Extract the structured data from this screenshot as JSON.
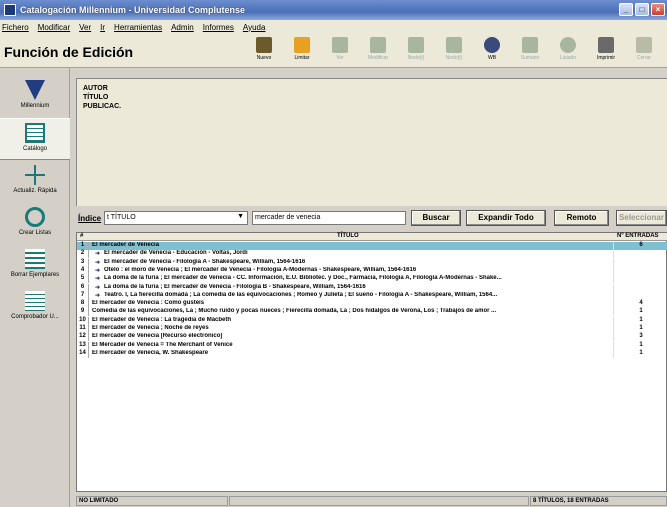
{
  "window": {
    "title": "Catalogación Millennium - Universidad Complutense"
  },
  "menu": [
    "Fichero",
    "Modificar",
    "Ver",
    "Ir",
    "Herramientas",
    "Admin",
    "Informes",
    "Ayuda"
  ],
  "mode_title": "Función de Edición",
  "toolbar": [
    {
      "label": "Nuevo",
      "icon": "new-record-icon",
      "enabled": true
    },
    {
      "label": "Limitar",
      "icon": "limit-icon",
      "enabled": true
    },
    {
      "label": "Ver",
      "icon": "view-icon",
      "enabled": false
    },
    {
      "label": "Modificar",
      "icon": "edit-icon",
      "enabled": false
    },
    {
      "label": "Nodo(t)",
      "icon": "nodes-icon",
      "enabled": false
    },
    {
      "label": "Nodo(t)",
      "icon": "unlink-icon",
      "enabled": false
    },
    {
      "label": "WB",
      "icon": "web-icon",
      "enabled": true
    },
    {
      "label": "Sumario",
      "icon": "summary-icon",
      "enabled": false
    },
    {
      "label": "Listado",
      "icon": "search-icon",
      "enabled": false
    },
    {
      "label": "Imprimir",
      "icon": "printer-icon",
      "enabled": true
    },
    {
      "label": "Cerrar",
      "icon": "close-icon",
      "enabled": false
    }
  ],
  "sidebar": [
    {
      "label": "Millennium",
      "icon": "millennium-icon"
    },
    {
      "label": "Catálogo",
      "icon": "catalog-icon"
    },
    {
      "label": "Actualiz. Rápida",
      "icon": "quick-update-icon"
    },
    {
      "label": "Crear Listas",
      "icon": "create-lists-icon"
    },
    {
      "label": "Borrar Ejemplares",
      "icon": "delete-items-icon"
    },
    {
      "label": "Comprobador U...",
      "icon": "checker-icon"
    }
  ],
  "record_fields": [
    "AUTOR",
    "TÍTULO",
    "PUBLICAC."
  ],
  "search": {
    "index_label": "Índice",
    "index_value": "t TÍTULO",
    "query": "mercader de venecia",
    "buttons": [
      "Buscar",
      "Expandir Todo",
      "Remoto",
      "Seleccionar"
    ]
  },
  "table": {
    "headers": [
      "#",
      "TÍTULO",
      "Nº ENTRADAS"
    ],
    "rows": [
      {
        "n": "1",
        "title": "El mercader de Venecia",
        "count": "6",
        "indent": false,
        "selected": true
      },
      {
        "n": "2",
        "title": "El mercader de Venecia - Educación - Voltas, Jordi",
        "count": "",
        "indent": true,
        "selected": false
      },
      {
        "n": "3",
        "title": "El mercader de Venecia - Filología A - Shakespeare, William, 1564-1616",
        "count": "",
        "indent": true,
        "selected": false
      },
      {
        "n": "4",
        "title": "Otelo : el moro de Venecia ; El mercader de Venecia - Filología A-Modernas - Shakespeare, William, 1564-1616",
        "count": "",
        "indent": true,
        "selected": false
      },
      {
        "n": "5",
        "title": "La doma de la furia ; El mercader de Venecia - CC. Información, E.U. Bibliotec. y Doc., Farmacia, Filología A, Filología A-Modernas - Shake...",
        "count": "",
        "indent": true,
        "selected": false
      },
      {
        "n": "6",
        "title": "La doma de la furia ; El mercader de Venecia - Filología B - Shakespeare, William, 1564-1616",
        "count": "",
        "indent": true,
        "selected": false
      },
      {
        "n": "7",
        "title": "Teatro. I, La fierecilla domada ; La comedia de las equivocaciones ; Romeo y Julieta ; El sueño - Filología A - Shakespeare, William, 1564...",
        "count": "",
        "indent": true,
        "selected": false
      },
      {
        "n": "8",
        "title": "El mercader de Venecia : Como gustéis",
        "count": "4",
        "indent": false,
        "selected": false
      },
      {
        "n": "9",
        "title": "Comedia de las equivocaciones, La ; Mucho ruido y pocas nueces ; Fierecilla domada, La ; Dos hidalgos de Verona, Los ; Trabajos de amor ...",
        "count": "1",
        "indent": false,
        "selected": false
      },
      {
        "n": "10",
        "title": "El mercader de Venecia : La tragedia de Mácbeth",
        "count": "1",
        "indent": false,
        "selected": false
      },
      {
        "n": "11",
        "title": "El mercader de Venecia ; Noche de reyes",
        "count": "1",
        "indent": false,
        "selected": false
      },
      {
        "n": "12",
        "title": "El mercader de Venecia [Recurso electrónico]",
        "count": "3",
        "indent": false,
        "selected": false
      },
      {
        "n": "13",
        "title": "El Mercader de Venecia = The Merchant of Venice",
        "count": "1",
        "indent": false,
        "selected": false
      },
      {
        "n": "14",
        "title": "El mercader de Venecia, W. Shakespeare",
        "count": "1",
        "indent": false,
        "selected": false
      }
    ]
  },
  "status": {
    "left": "NO LIMITADO",
    "middle": "",
    "right": "8 TÍTULOS, 18 ENTRADAS"
  }
}
